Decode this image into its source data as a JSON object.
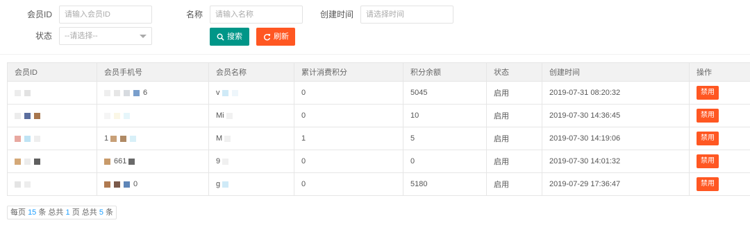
{
  "filters": {
    "member_id": {
      "label": "会员ID",
      "placeholder": "请输入会员ID"
    },
    "name": {
      "label": "名称",
      "placeholder": "请输入名称"
    },
    "created_time": {
      "label": "创建时间",
      "placeholder": "请选择时间"
    },
    "status": {
      "label": "状态",
      "selected": "--请选择--"
    }
  },
  "buttons": {
    "search": "搜索",
    "refresh": "刷新"
  },
  "table": {
    "headers": [
      "会员ID",
      "会员手机号",
      "会员名称",
      "累计消费积分",
      "积分余额",
      "状态",
      "创建时间",
      "操作"
    ],
    "rows": [
      {
        "id": "",
        "phone": "6",
        "name": "v",
        "points_total": "0",
        "points_balance": "5045",
        "status": "启用",
        "created": "2019-07-31 08:20:32",
        "action": "禁用"
      },
      {
        "id": "",
        "phone": "",
        "name": "Mi",
        "points_total": "0",
        "points_balance": "10",
        "status": "启用",
        "created": "2019-07-30 14:36:45",
        "action": "禁用"
      },
      {
        "id": "",
        "phone": "1",
        "name": "M",
        "points_total": "1",
        "points_balance": "5",
        "status": "启用",
        "created": "2019-07-30 14:19:06",
        "action": "禁用"
      },
      {
        "id": "",
        "phone": "661",
        "name": "9",
        "points_total": "0",
        "points_balance": "0",
        "status": "启用",
        "created": "2019-07-30 14:01:32",
        "action": "禁用"
      },
      {
        "id": "",
        "phone": "0",
        "name": "g",
        "points_total": "0",
        "points_balance": "5180",
        "status": "启用",
        "created": "2019-07-29 17:36:47",
        "action": "禁用"
      }
    ]
  },
  "pager": {
    "prefix": "每页",
    "per_page": "15",
    "mid1": "条 总共",
    "pages": "1",
    "mid2": "页 总共",
    "total": "5",
    "suffix": "条"
  },
  "colors": {
    "search_btn": "#009688",
    "refresh_btn": "#ff5722",
    "status_enabled": "#5fb878",
    "accent_number": "#1e9fff"
  }
}
